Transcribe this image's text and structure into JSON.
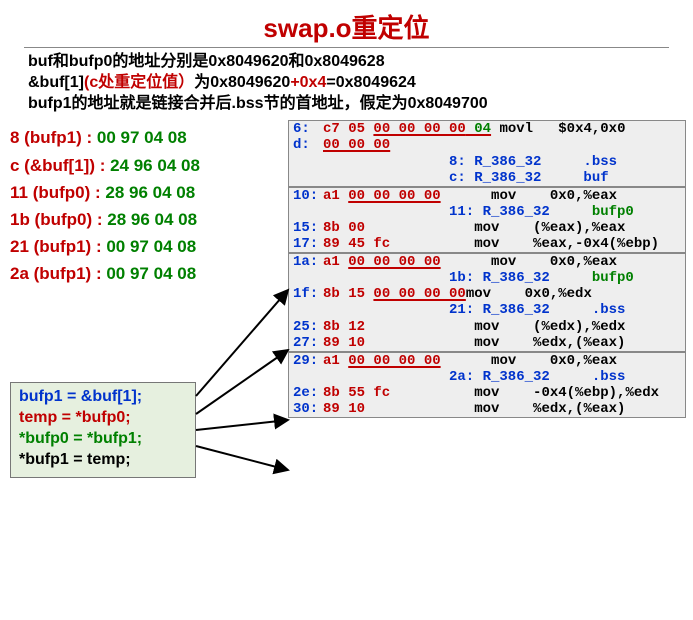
{
  "title": "swap.o重定位",
  "intro": {
    "l1a": "buf和bufp0的地址分别是0x8049620和0x8049628",
    "l2a": "&buf[1]",
    "l2b": "(c处重定位值）",
    "l2c": "为0x8049620",
    "l2d": "+0x4",
    "l2e": "=0x8049624",
    "l3": "bufp1的地址就是链接合并后.bss节的首地址，假定为0x8049700"
  },
  "left": [
    {
      "a": "8 (bufp1) : ",
      "v": "00 97 04 08"
    },
    {
      "a": "c (&buf[1]) : ",
      "v": "24 96 04 08"
    },
    {
      "a": "11 (bufp0) : ",
      "v": "28 96 04 08"
    },
    {
      "a": "1b (bufp0) : ",
      "v": "28 96 04 08"
    },
    {
      "a": "21 (bufp1) : ",
      "v": "00 97 04 08"
    },
    {
      "a": "2a (bufp1) : ",
      "v": "00 97 04 08"
    }
  ],
  "src": {
    "l1": "bufp1 = &buf[1];",
    "l2": "temp = *bufp0;",
    "l3": "*bufp0 = *bufp1;",
    "l4": "*bufp1 = temp;"
  },
  "panels": [
    {
      "rows": [
        {
          "addr": "6:",
          "hexr": "c7 05 ",
          "hexu": "00 00 00 00",
          "hexg": " 04",
          "ins": " movl   $0x4,0x0"
        },
        {
          "addr": "d:",
          "hexr": "",
          "hexu": "00 00 00",
          "hexg": "",
          "ins": ""
        },
        {
          "rel": "8: R_386_32",
          "sym": ".bss",
          "sc": "b"
        },
        {
          "rel": "c: R_386_32",
          "sym": "buf",
          "sc": "b"
        }
      ]
    },
    {
      "rows": [
        {
          "addr": "10:",
          "hexr": "a1 ",
          "hexu": "00 00 00 00",
          "hexg": "",
          "ins": "      mov    0x0,%eax"
        },
        {
          "rel": "11: R_386_32",
          "sym": "bufp0",
          "sc": "g"
        },
        {
          "addr": "15:",
          "hexr": "8b 00",
          "hexu": "",
          "hexg": "",
          "ins": "             mov    (%eax),%eax"
        },
        {
          "addr": "17:",
          "hexr": "89 45 fc",
          "hexu": "",
          "hexg": "",
          "ins": "          mov    %eax,-0x4(%ebp)"
        }
      ]
    },
    {
      "rows": [
        {
          "addr": "1a:",
          "hexr": "a1 ",
          "hexu": "00 00 00 00",
          "hexg": "",
          "ins": "      mov    0x0,%eax"
        },
        {
          "rel": "1b: R_386_32",
          "sym": "bufp0",
          "sc": "g"
        },
        {
          "addr": "1f:",
          "hexr": "8b 15 ",
          "hexu": "00 00 00 00",
          "hexg": "",
          "ins": "mov    0x0,%edx"
        },
        {
          "rel": "21: R_386_32",
          "sym": ".bss",
          "sc": "b"
        },
        {
          "addr": "25:",
          "hexr": "8b 12",
          "hexu": "",
          "hexg": "",
          "ins": "             mov    (%edx),%edx"
        },
        {
          "addr": "27:",
          "hexr": "89 10",
          "hexu": "",
          "hexg": "",
          "ins": "             mov    %edx,(%eax)"
        }
      ]
    },
    {
      "rows": [
        {
          "addr": "29:",
          "hexr": "a1 ",
          "hexu": "00 00 00 00",
          "hexg": "",
          "ins": "      mov    0x0,%eax"
        },
        {
          "rel": "2a: R_386_32",
          "sym": ".bss",
          "sc": "b"
        },
        {
          "addr": "2e:",
          "hexr": "8b 55 fc",
          "hexu": "",
          "hexg": "",
          "ins": "          mov    -0x4(%ebp),%edx"
        },
        {
          "addr": "30:",
          "hexr": "89 10",
          "hexu": "",
          "hexg": "",
          "ins": "             mov    %edx,(%eax)"
        }
      ]
    }
  ]
}
